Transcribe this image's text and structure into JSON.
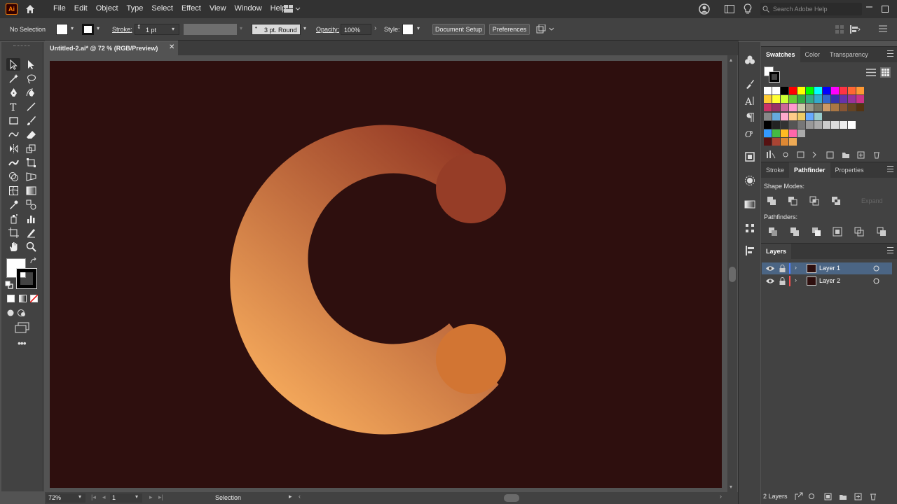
{
  "menubar": {
    "logo": "Ai",
    "items": [
      "File",
      "Edit",
      "Object",
      "Type",
      "Select",
      "Effect",
      "View",
      "Window",
      "Help"
    ],
    "search_placeholder": "Search Adobe Help"
  },
  "controlbar": {
    "selection": "No Selection",
    "stroke_label": "Stroke:",
    "stroke_value": "1 pt",
    "profile": "3 pt. Round",
    "opacity_label": "Opacity:",
    "opacity_value": "100%",
    "style_label": "Style:",
    "doc_setup": "Document Setup",
    "preferences": "Preferences"
  },
  "document": {
    "tab_title": "Untitled-2.ai* @ 72 % (RGB/Preview)",
    "artboard_color": "#2e0f0e"
  },
  "statusbar": {
    "zoom": "72%",
    "artboard_num": "1",
    "tool": "Selection"
  },
  "panels": {
    "swatch_tabs": [
      "Swatches",
      "Color",
      "Transparency"
    ],
    "pathfinder_tabs": [
      "Stroke",
      "Pathfinder",
      "Properties"
    ],
    "shape_modes": "Shape Modes:",
    "pathfinders": "Pathfinders:",
    "expand": "Expand",
    "layers_title": "Layers",
    "layers": [
      {
        "name": "Layer 1",
        "color": "#4f80ff",
        "selected": true
      },
      {
        "name": "Layer 2",
        "color": "#ff4f4f",
        "selected": false
      }
    ],
    "layers_count": "2 Layers"
  },
  "colors": {
    "accent": "#ff7c00",
    "gradient_start": "#f2a65a",
    "gradient_end": "#8f3322",
    "knob": "#d27533"
  },
  "swatches": [
    [
      "#ffffff",
      "#ffffff",
      "#000000",
      "#ff0000",
      "#ffff00",
      "#00ff00",
      "#00ffff",
      "#0000ff",
      "#ff00ff",
      "#ff3344",
      "#ff6633",
      "#ff9933"
    ],
    [
      "#ffcc33",
      "#ffff33",
      "#ccff33",
      "#66cc33",
      "#33aa44",
      "#33aa88",
      "#33aacc",
      "#3366cc",
      "#3333aa",
      "#6633aa",
      "#993399",
      "#cc3388"
    ],
    [
      "#cc3366",
      "#993366",
      "#cc6699",
      "#ff99cc",
      "#ccccaa",
      "#999988",
      "#777766",
      "#cc9966",
      "#aa7744",
      "#885533",
      "#664422",
      "#553311"
    ],
    [
      "#888888",
      "#66aadd",
      "#ffaacc",
      "#ffcc88",
      "#eecc66",
      "#66aaff",
      "#99cccc"
    ],
    [
      "#000000",
      "#222222",
      "#333333",
      "#555555",
      "#777777",
      "#999999",
      "#aaaaaa",
      "#cccccc",
      "#dddddd",
      "#eeeeee",
      "#ffffff"
    ],
    [
      "#3399ff",
      "#44bb44",
      "#ffbb22",
      "#ff66aa",
      "#aaaaaa"
    ],
    [
      "#551111",
      "#aa4433",
      "#dd8833",
      "#eeaa55"
    ]
  ]
}
